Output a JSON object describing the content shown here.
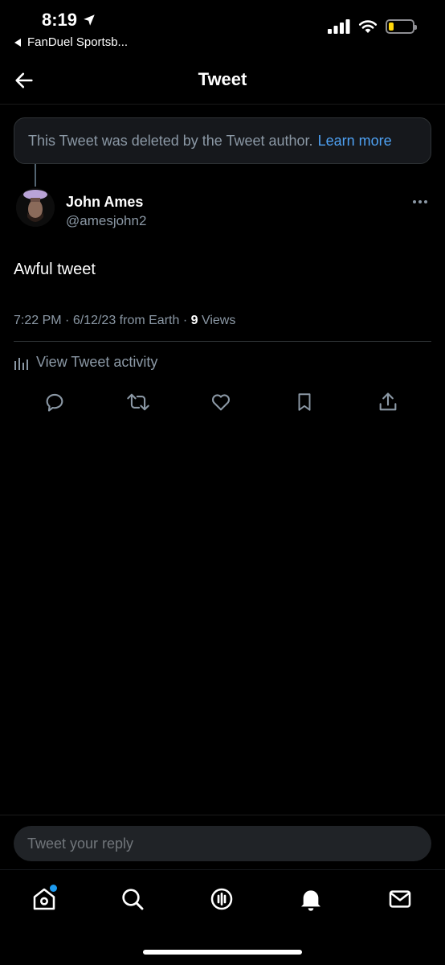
{
  "status_bar": {
    "time": "8:19",
    "back_app_label": "FanDuel Sportsb...",
    "battery_level": 0.2,
    "battery_color": "#ffd60a"
  },
  "header": {
    "back_icon": "arrow-left-icon",
    "title": "Tweet"
  },
  "deleted_notice": {
    "text": "This Tweet was deleted by the Tweet author.",
    "link": "Learn more"
  },
  "tweet": {
    "author_name": "John Ames",
    "author_handle": "@amesjohn2",
    "text": "Awful tweet",
    "time": "7:22 PM",
    "separator": "·",
    "date": "6/12/23",
    "source": "from Earth",
    "views_count": "9",
    "views_label": "Views",
    "activity_label": "View Tweet activity"
  },
  "actions": [
    "reply-icon",
    "retweet-icon",
    "like-icon",
    "bookmark-icon",
    "share-icon"
  ],
  "reply": {
    "placeholder": "Tweet your reply"
  },
  "tabbar": [
    "home-icon",
    "search-icon",
    "spaces-icon",
    "notifications-icon",
    "messages-icon"
  ],
  "colors": {
    "accent": "#1d9bf0",
    "link": "#4ea1f3",
    "muted": "#8b98a5",
    "background": "#000000"
  }
}
